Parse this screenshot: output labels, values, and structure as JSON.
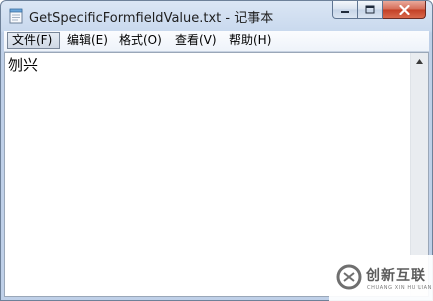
{
  "window": {
    "title": "GetSpecificFormfieldValue.txt - 记事本"
  },
  "menu": [
    {
      "label": "文件(F)"
    },
    {
      "label": "编辑(E)"
    },
    {
      "label": "格式(O)"
    },
    {
      "label": "查看(V)"
    },
    {
      "label": "帮助(H)"
    }
  ],
  "editor": {
    "content": "刎兴"
  },
  "watermark": {
    "name_cn": "创新互联",
    "name_en": "CHUANG XIN HU LIAN"
  },
  "icons": {
    "app": "notepad-icon",
    "minimize": "minimize-icon",
    "maximize": "maximize-icon",
    "close": "close-icon"
  },
  "colors": {
    "titlebar": "#c9d9ee",
    "close_button": "#c33f25",
    "watermark_logo": "#6f6f6f"
  }
}
